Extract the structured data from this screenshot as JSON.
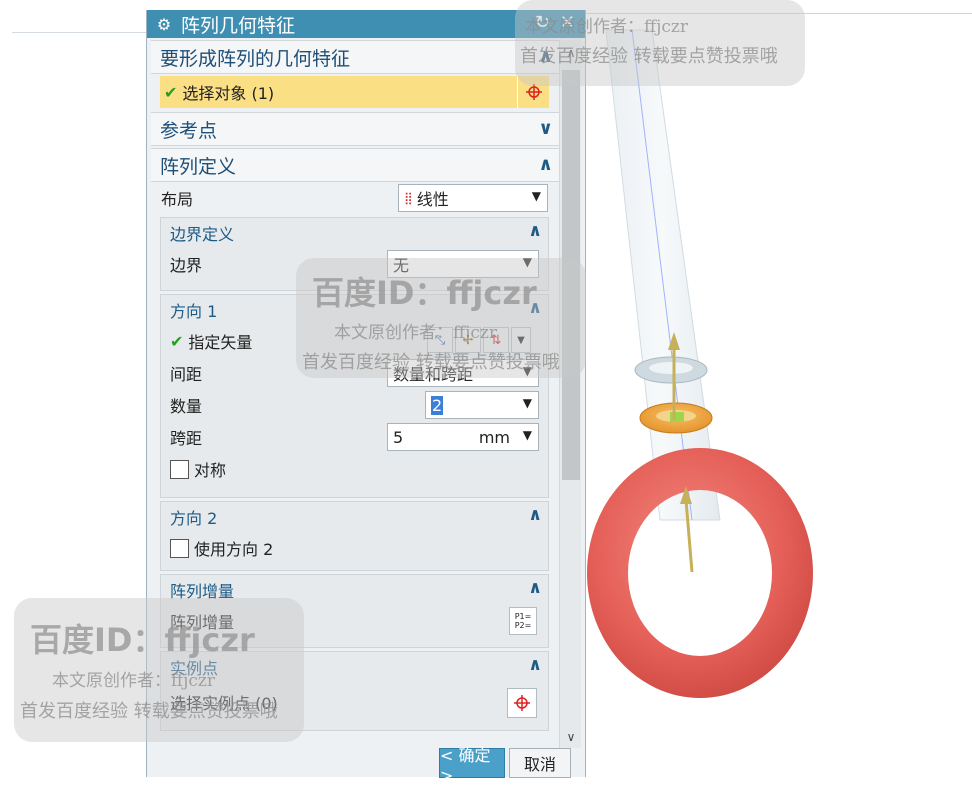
{
  "dialog": {
    "title": "阵列几何特征",
    "title_icons": [
      "gear-icon",
      "reset-icon",
      "close-icon"
    ]
  },
  "sections": {
    "features": {
      "header": "要形成阵列的几何特征",
      "select_label": "选择对象 (1)"
    },
    "reference_point": {
      "header": "参考点"
    },
    "array_def": {
      "header": "阵列定义",
      "layout_label": "布局",
      "layout_value": "线性"
    },
    "boundary": {
      "header": "边界定义",
      "boundary_label": "边界",
      "boundary_value": "无"
    },
    "direction1": {
      "header": "方向 1",
      "vector_label": "指定矢量",
      "spacing_label": "间距",
      "spacing_value": "数量和跨距",
      "count_label": "数量",
      "count_value": "2",
      "span_label": "跨距",
      "span_value": "5",
      "span_unit": "mm",
      "symmetric_label": "对称"
    },
    "direction2": {
      "header": "方向 2",
      "use_label": "使用方向 2"
    },
    "increment": {
      "header": "阵列增量",
      "label": "阵列增量",
      "icon_text": "P1=\nP2="
    },
    "instance_point": {
      "header": "实例点",
      "select_label": "选择实例点 (0)"
    }
  },
  "buttons": {
    "ok": "< 确定 >",
    "cancel": "取消"
  },
  "watermarks": {
    "id_line": "百度ID：ffjczr",
    "author_line": "本文原创作者：ffjczr",
    "publish_line": "首发百度经验 转载要点赞投票哦"
  },
  "colors": {
    "title_bar": "#3f8fb3",
    "selected_row": "#fbdf84",
    "ring_large": "#e8625a",
    "ring_orange": "#f0a23c",
    "ring_grey": "#c9d4dc",
    "vector_arrow": "#c7b05a"
  }
}
